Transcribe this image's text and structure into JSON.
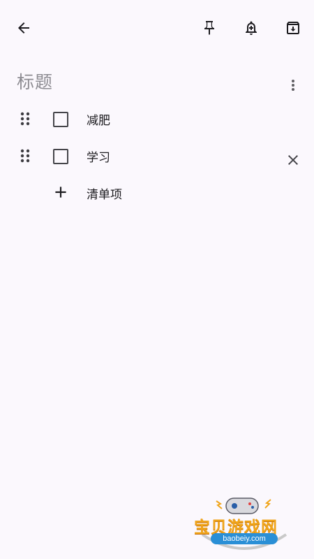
{
  "header": {
    "icons": [
      "back-arrow-icon",
      "pin-icon",
      "reminder-bell-icon",
      "archive-icon"
    ]
  },
  "note": {
    "title_placeholder": "标题",
    "items": [
      {
        "label": "减肥",
        "checked": false
      },
      {
        "label": "学习",
        "checked": false
      }
    ],
    "add_item_label": "清单项"
  },
  "watermark": {
    "name": "宝贝游戏网",
    "url": "baobeiy.com"
  },
  "colors": {
    "background": "#fbf8fd",
    "text": "#1c1b1f",
    "placeholder": "#8d8c92",
    "watermark": "#f0a51a"
  }
}
